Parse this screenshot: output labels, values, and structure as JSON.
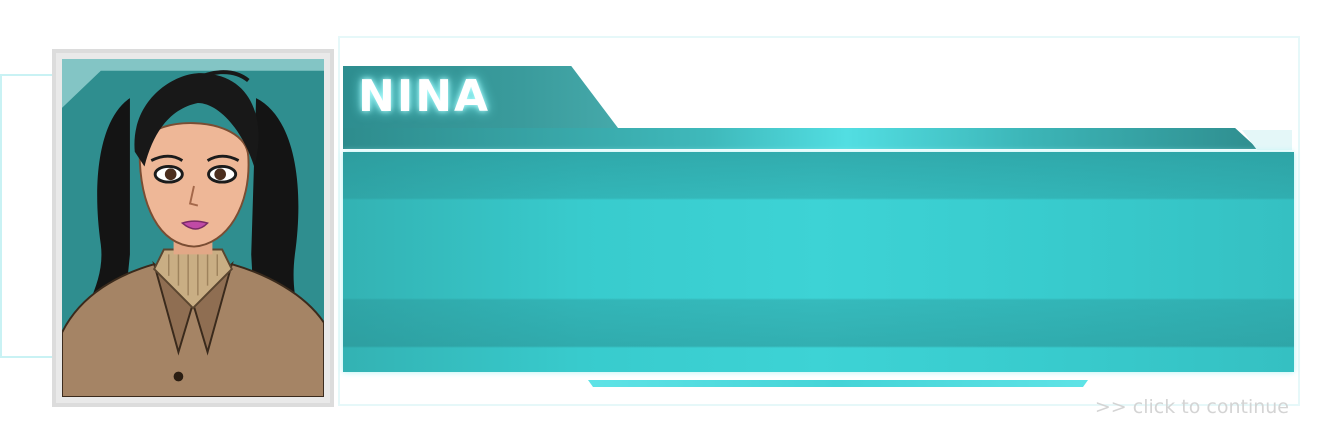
{
  "speaker": {
    "name": "NINA"
  },
  "dialogue": {
    "text": ""
  },
  "hint": {
    "continue_label": ">> click to continue"
  },
  "colors": {
    "teal_dark": "#2e8d8f",
    "teal_bright": "#3dd3d5",
    "glow": "#c9f2f4",
    "hint_text": "#d4d4d4"
  },
  "portrait": {
    "character": "Nina",
    "icon": "character-portrait"
  }
}
